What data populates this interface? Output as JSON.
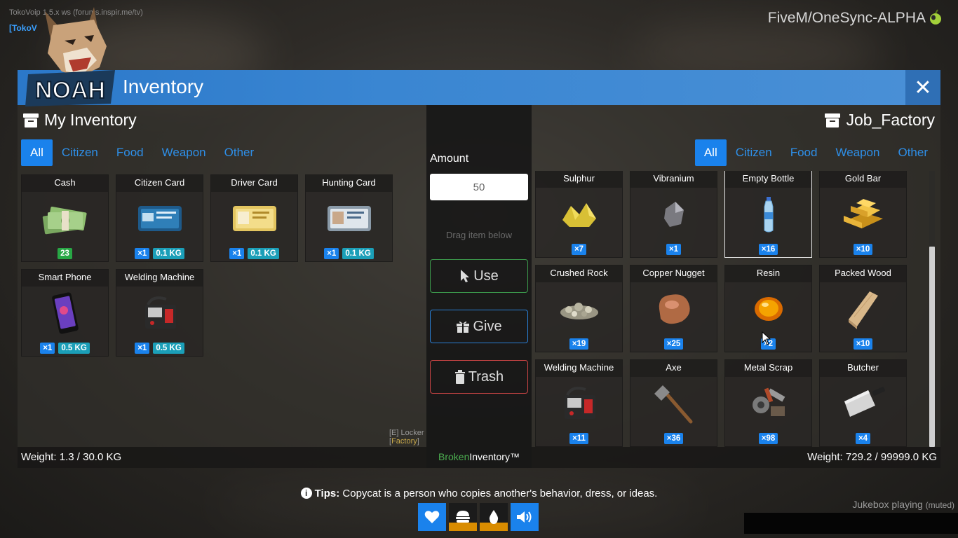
{
  "server": {
    "label": "TokoVoip 1.5.x ws (forums.inspir.me/tv)",
    "tag": "[TokoV",
    "platform": "FiveM/OneSync-ALPHA"
  },
  "header": {
    "title": "Inventory",
    "close": "✕"
  },
  "left": {
    "title": "My Inventory",
    "tabs": [
      "All",
      "Citizen",
      "Food",
      "Weapon",
      "Other"
    ],
    "active_tab": "All",
    "items": [
      {
        "name": "Cash",
        "count": "23"
      },
      {
        "name": "Citizen Card",
        "qty": "×1",
        "weight": "0.1 KG"
      },
      {
        "name": "Driver Card",
        "qty": "×1",
        "weight": "0.1 KG"
      },
      {
        "name": "Hunting Card",
        "qty": "×1",
        "weight": "0.1 KG"
      },
      {
        "name": "Smart Phone",
        "qty": "×1",
        "weight": "0.5 KG"
      },
      {
        "name": "Welding Machine",
        "qty": "×1",
        "weight": "0.5 KG"
      }
    ],
    "weight": "Weight: 1.3 / 30.0 KG"
  },
  "middle": {
    "amount_label": "Amount",
    "amount_value": "50",
    "drag_hint": "Drag item below",
    "use": "Use",
    "give": "Give",
    "trash": "Trash",
    "brand_a": "Broken",
    "brand_b": "Inventory™"
  },
  "right": {
    "title": "Job_Factory",
    "tabs": [
      "All",
      "Citizen",
      "Food",
      "Weapon",
      "Other"
    ],
    "active_tab": "All",
    "items": [
      {
        "name": "Sulphur",
        "qty": "×7"
      },
      {
        "name": "Vibranium",
        "qty": "×1"
      },
      {
        "name": "Empty Bottle",
        "qty": "×16"
      },
      {
        "name": "Gold Bar",
        "qty": "×10"
      },
      {
        "name": "Crushed Rock",
        "qty": "×19"
      },
      {
        "name": "Copper Nugget",
        "qty": "×25"
      },
      {
        "name": "Resin",
        "qty": "×2"
      },
      {
        "name": "Packed Wood",
        "qty": "×10"
      },
      {
        "name": "Welding Machine",
        "qty": "×11"
      },
      {
        "name": "Axe",
        "qty": "×36"
      },
      {
        "name": "Metal Scrap",
        "qty": "×98"
      },
      {
        "name": "Butcher",
        "qty": "×4"
      }
    ],
    "weight": "Weight: 729.2 / 99999.0 KG"
  },
  "locker_hint": {
    "key": "[E] Locker [",
    "name": "Factory",
    "end": "]"
  },
  "tips": {
    "label": "Tips:",
    "text": "Copycat is a person who copies another's behavior, dress, or ideas."
  },
  "hud": [
    {
      "icon": "heart-icon",
      "color": "#1a82ec",
      "level": 1.0
    },
    {
      "icon": "burger-icon",
      "color": "#d98c00",
      "level": 0.3
    },
    {
      "icon": "water-drop-icon",
      "color": "#d98c00",
      "level": 0.3
    },
    {
      "icon": "speaker-icon",
      "color": "#1a82ec",
      "level": 1.0
    }
  ],
  "jukebox": {
    "text": "Jukebox playing",
    "muted": "(muted)"
  },
  "colors": {
    "accent": "#1a82ec",
    "header": "#3a86d2",
    "brand_green": "#4caf50"
  }
}
